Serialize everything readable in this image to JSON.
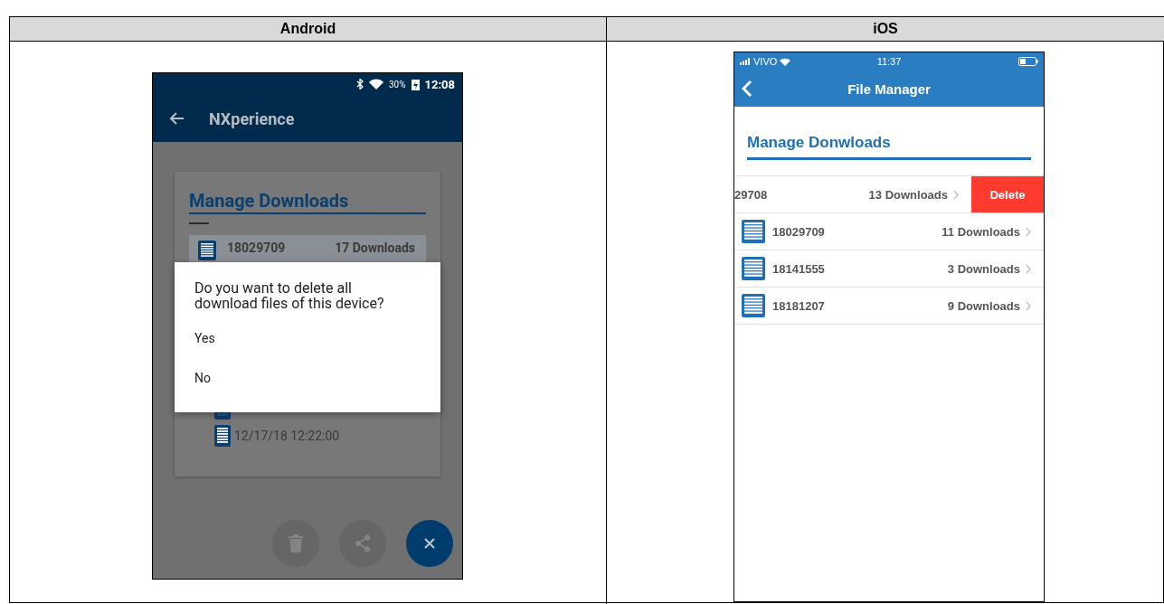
{
  "table": {
    "columns": [
      {
        "heading": "Android"
      },
      {
        "heading": "iOS"
      }
    ]
  },
  "android": {
    "status_bar": {
      "battery": "30%",
      "time": "12:08"
    },
    "app_bar": {
      "title": "NXperience"
    },
    "card": {
      "title": "Manage Downloads",
      "device_row": {
        "name": "18029709",
        "count": "17 Downloads",
        "selected": true
      },
      "file_rows": [
        {
          "name": "12/17/18 12:22:00"
        }
      ]
    },
    "dialog": {
      "message": "Do you want to delete all download files of this device?",
      "options": [
        "Yes",
        "No"
      ]
    }
  },
  "ios": {
    "status_bar": {
      "carrier": "VIVO",
      "time": "11:37"
    },
    "nav_bar": {
      "title": "File Manager"
    },
    "section_title": "Manage Donwloads",
    "rows": [
      {
        "name": "29708",
        "count": "13 Downloads",
        "swiped": true,
        "action": "Delete"
      },
      {
        "name": "18029709",
        "count": "11 Downloads",
        "swiped": false
      },
      {
        "name": "18141555",
        "count": "3 Downloads",
        "swiped": false
      },
      {
        "name": "18181207",
        "count": "9 Downloads",
        "swiped": false
      }
    ]
  }
}
